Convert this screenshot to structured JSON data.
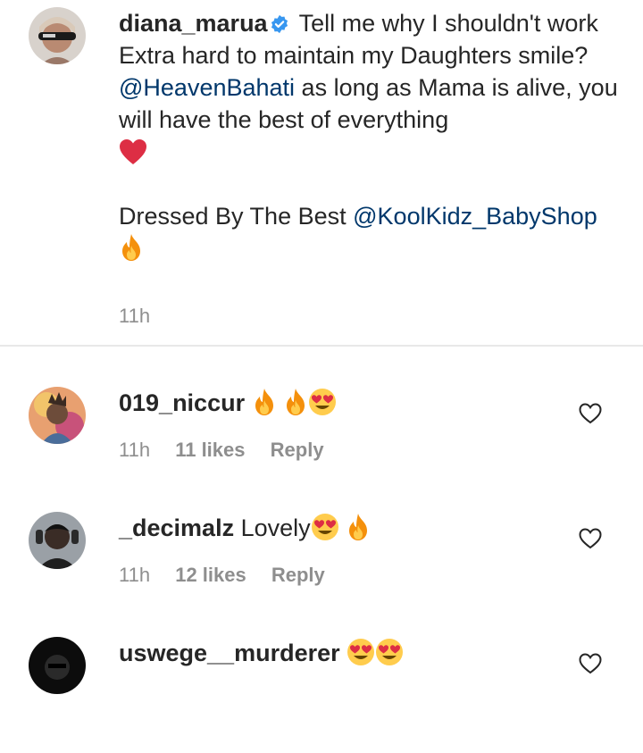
{
  "post": {
    "username": "diana_marua",
    "text_before_mention": "Tell me why I shouldn't work Extra hard to maintain my Daughters smile?",
    "mention1": "@HeavenBahati",
    "text_after_mention": "as long as Mama is alive, you will have the best of everything",
    "emoji_1": "red-heart",
    "line2_text": "Dressed By The Best",
    "mention2": "@KoolKidz_BabyShop",
    "emoji_2": "fire",
    "time": "11h"
  },
  "comments": [
    {
      "username": "019_niccur",
      "text": "",
      "emojis": [
        "fire",
        "fire",
        "heart-eyes"
      ],
      "time": "11h",
      "likes": "11 likes",
      "reply": "Reply"
    },
    {
      "username": "_decimalz",
      "text": "Lovely",
      "emojis": [
        "heart-eyes",
        "fire"
      ],
      "time": "11h",
      "likes": "12 likes",
      "reply": "Reply"
    },
    {
      "username": "uswege__murderer",
      "text": "",
      "emojis": [
        "heart-eyes",
        "heart-eyes"
      ]
    }
  ],
  "colors": {
    "mention": "#00376b",
    "meta": "#8e8e8e",
    "verified": "#3897f0",
    "text": "#262626"
  }
}
